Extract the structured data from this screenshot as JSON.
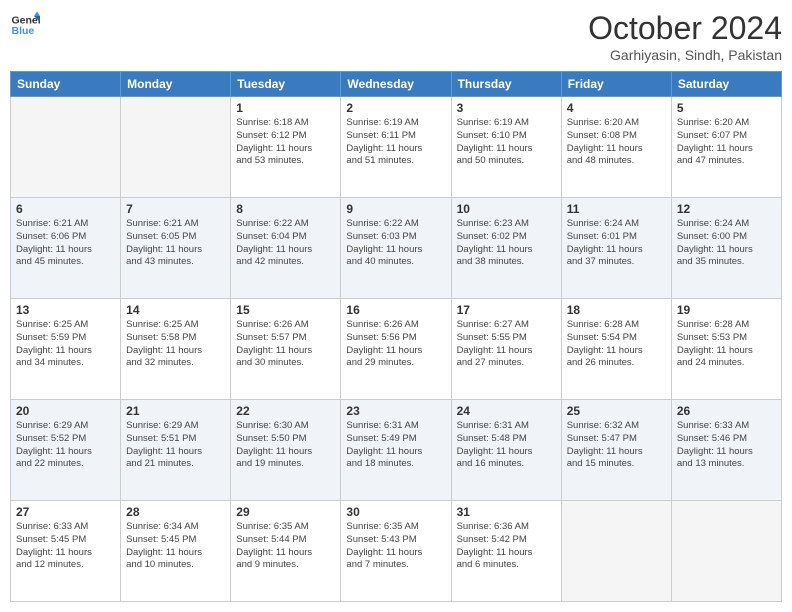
{
  "header": {
    "logo_line1": "General",
    "logo_line2": "Blue",
    "month": "October 2024",
    "location": "Garhiyasin, Sindh, Pakistan"
  },
  "weekdays": [
    "Sunday",
    "Monday",
    "Tuesday",
    "Wednesday",
    "Thursday",
    "Friday",
    "Saturday"
  ],
  "weeks": [
    [
      {
        "day": "",
        "info": ""
      },
      {
        "day": "",
        "info": ""
      },
      {
        "day": "1",
        "info": "Sunrise: 6:18 AM\nSunset: 6:12 PM\nDaylight: 11 hours\nand 53 minutes."
      },
      {
        "day": "2",
        "info": "Sunrise: 6:19 AM\nSunset: 6:11 PM\nDaylight: 11 hours\nand 51 minutes."
      },
      {
        "day": "3",
        "info": "Sunrise: 6:19 AM\nSunset: 6:10 PM\nDaylight: 11 hours\nand 50 minutes."
      },
      {
        "day": "4",
        "info": "Sunrise: 6:20 AM\nSunset: 6:08 PM\nDaylight: 11 hours\nand 48 minutes."
      },
      {
        "day": "5",
        "info": "Sunrise: 6:20 AM\nSunset: 6:07 PM\nDaylight: 11 hours\nand 47 minutes."
      }
    ],
    [
      {
        "day": "6",
        "info": "Sunrise: 6:21 AM\nSunset: 6:06 PM\nDaylight: 11 hours\nand 45 minutes."
      },
      {
        "day": "7",
        "info": "Sunrise: 6:21 AM\nSunset: 6:05 PM\nDaylight: 11 hours\nand 43 minutes."
      },
      {
        "day": "8",
        "info": "Sunrise: 6:22 AM\nSunset: 6:04 PM\nDaylight: 11 hours\nand 42 minutes."
      },
      {
        "day": "9",
        "info": "Sunrise: 6:22 AM\nSunset: 6:03 PM\nDaylight: 11 hours\nand 40 minutes."
      },
      {
        "day": "10",
        "info": "Sunrise: 6:23 AM\nSunset: 6:02 PM\nDaylight: 11 hours\nand 38 minutes."
      },
      {
        "day": "11",
        "info": "Sunrise: 6:24 AM\nSunset: 6:01 PM\nDaylight: 11 hours\nand 37 minutes."
      },
      {
        "day": "12",
        "info": "Sunrise: 6:24 AM\nSunset: 6:00 PM\nDaylight: 11 hours\nand 35 minutes."
      }
    ],
    [
      {
        "day": "13",
        "info": "Sunrise: 6:25 AM\nSunset: 5:59 PM\nDaylight: 11 hours\nand 34 minutes."
      },
      {
        "day": "14",
        "info": "Sunrise: 6:25 AM\nSunset: 5:58 PM\nDaylight: 11 hours\nand 32 minutes."
      },
      {
        "day": "15",
        "info": "Sunrise: 6:26 AM\nSunset: 5:57 PM\nDaylight: 11 hours\nand 30 minutes."
      },
      {
        "day": "16",
        "info": "Sunrise: 6:26 AM\nSunset: 5:56 PM\nDaylight: 11 hours\nand 29 minutes."
      },
      {
        "day": "17",
        "info": "Sunrise: 6:27 AM\nSunset: 5:55 PM\nDaylight: 11 hours\nand 27 minutes."
      },
      {
        "day": "18",
        "info": "Sunrise: 6:28 AM\nSunset: 5:54 PM\nDaylight: 11 hours\nand 26 minutes."
      },
      {
        "day": "19",
        "info": "Sunrise: 6:28 AM\nSunset: 5:53 PM\nDaylight: 11 hours\nand 24 minutes."
      }
    ],
    [
      {
        "day": "20",
        "info": "Sunrise: 6:29 AM\nSunset: 5:52 PM\nDaylight: 11 hours\nand 22 minutes."
      },
      {
        "day": "21",
        "info": "Sunrise: 6:29 AM\nSunset: 5:51 PM\nDaylight: 11 hours\nand 21 minutes."
      },
      {
        "day": "22",
        "info": "Sunrise: 6:30 AM\nSunset: 5:50 PM\nDaylight: 11 hours\nand 19 minutes."
      },
      {
        "day": "23",
        "info": "Sunrise: 6:31 AM\nSunset: 5:49 PM\nDaylight: 11 hours\nand 18 minutes."
      },
      {
        "day": "24",
        "info": "Sunrise: 6:31 AM\nSunset: 5:48 PM\nDaylight: 11 hours\nand 16 minutes."
      },
      {
        "day": "25",
        "info": "Sunrise: 6:32 AM\nSunset: 5:47 PM\nDaylight: 11 hours\nand 15 minutes."
      },
      {
        "day": "26",
        "info": "Sunrise: 6:33 AM\nSunset: 5:46 PM\nDaylight: 11 hours\nand 13 minutes."
      }
    ],
    [
      {
        "day": "27",
        "info": "Sunrise: 6:33 AM\nSunset: 5:45 PM\nDaylight: 11 hours\nand 12 minutes."
      },
      {
        "day": "28",
        "info": "Sunrise: 6:34 AM\nSunset: 5:45 PM\nDaylight: 11 hours\nand 10 minutes."
      },
      {
        "day": "29",
        "info": "Sunrise: 6:35 AM\nSunset: 5:44 PM\nDaylight: 11 hours\nand 9 minutes."
      },
      {
        "day": "30",
        "info": "Sunrise: 6:35 AM\nSunset: 5:43 PM\nDaylight: 11 hours\nand 7 minutes."
      },
      {
        "day": "31",
        "info": "Sunrise: 6:36 AM\nSunset: 5:42 PM\nDaylight: 11 hours\nand 6 minutes."
      },
      {
        "day": "",
        "info": ""
      },
      {
        "day": "",
        "info": ""
      }
    ]
  ]
}
